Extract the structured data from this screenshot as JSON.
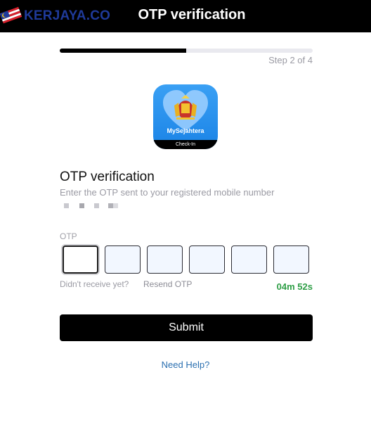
{
  "header": {
    "brand_text": "KERJAYA.CO",
    "title": "OTP verification"
  },
  "progress": {
    "step_text": "Step 2 of 4",
    "fraction_complete": 0.5
  },
  "app_icon": {
    "name": "MySejahtera",
    "band_text": "Check-In"
  },
  "content": {
    "heading": "OTP verification",
    "subtext": "Enter the OTP sent to your registered mobile number"
  },
  "otp": {
    "label": "OTP",
    "digits": [
      "",
      "",
      "",
      "",
      "",
      ""
    ],
    "didnt_receive": "Didn't receive yet?",
    "resend_label": "Resend OTP",
    "timer": "04m 52s"
  },
  "actions": {
    "submit_label": "Submit",
    "help_label": "Need Help?"
  },
  "colors": {
    "topbar": "#000000",
    "brand": "#1f3a9a",
    "timer": "#2e9e46",
    "help_link": "#2a6fb0",
    "app_icon": "#2a90ec"
  }
}
